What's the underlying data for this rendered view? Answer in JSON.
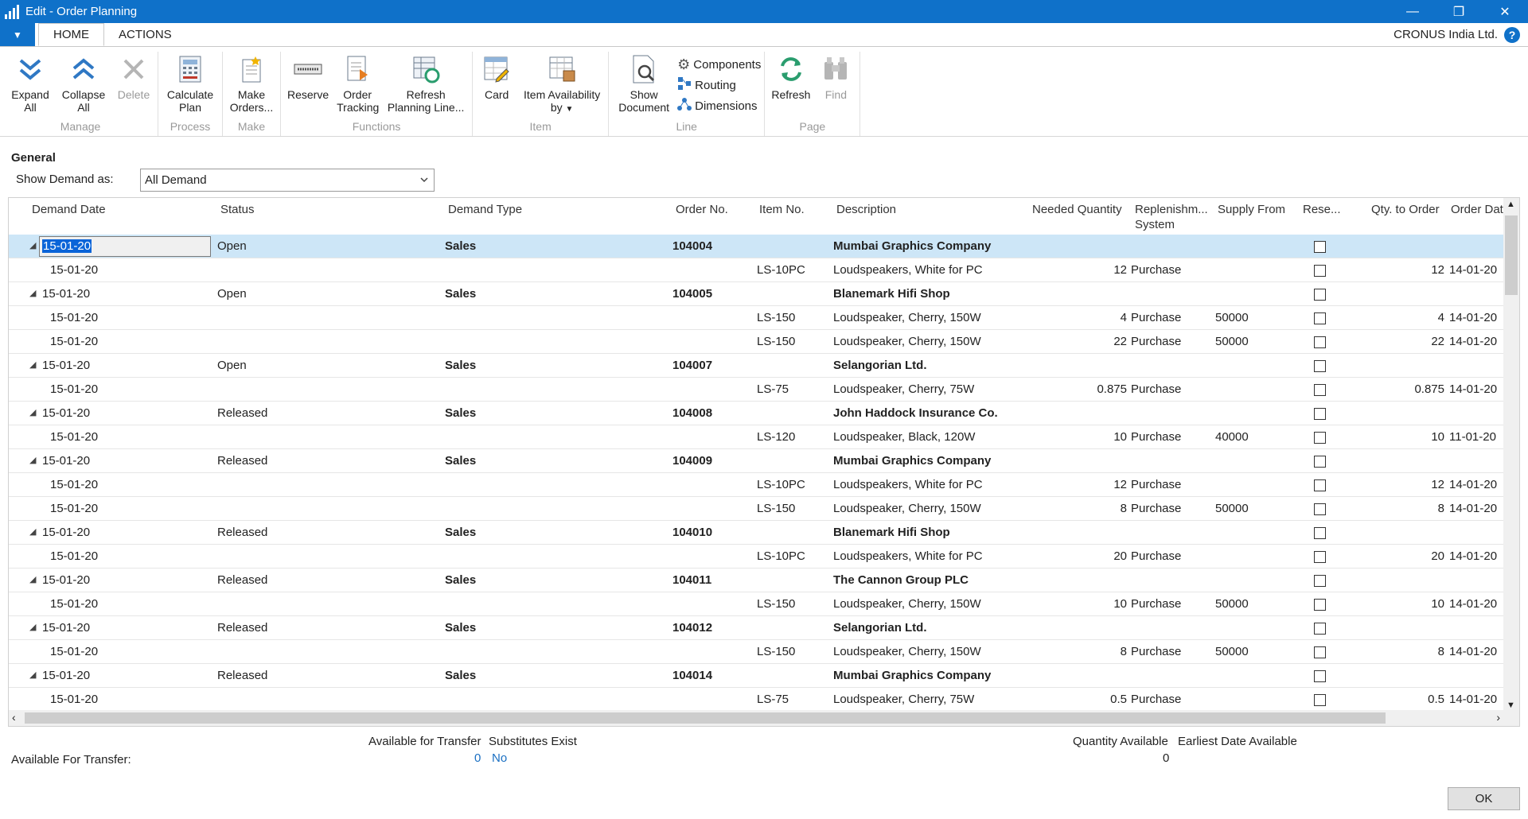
{
  "window": {
    "title": "Edit - Order Planning",
    "minimize": "—",
    "restore": "❐",
    "close": "✕"
  },
  "tabs": [
    {
      "label": "HOME"
    },
    {
      "label": "ACTIONS"
    }
  ],
  "company": "CRONUS India Ltd.",
  "ribbon": {
    "manage": {
      "name": "Manage",
      "expand": "Expand All",
      "collapse": "Collapse All",
      "delete": "Delete"
    },
    "process": {
      "name": "Process",
      "calculate": "Calculate Plan"
    },
    "make": {
      "name": "Make",
      "make_orders": "Make Orders..."
    },
    "functions": {
      "name": "Functions",
      "reserve": "Reserve",
      "order_tracking": "Order Tracking",
      "refresh_planning": "Refresh Planning Line..."
    },
    "item": {
      "name": "Item",
      "card": "Card",
      "item_availability": "Item Availability by"
    },
    "line": {
      "name": "Line",
      "show_document": "Show Document",
      "components": "Components",
      "routing": "Routing",
      "dimensions": "Dimensions"
    },
    "page": {
      "name": "Page",
      "refresh": "Refresh",
      "find": "Find"
    }
  },
  "general": {
    "title": "General",
    "show_demand_label": "Show Demand as:",
    "show_demand_value": "All Demand"
  },
  "columns": {
    "demand_date": "Demand Date",
    "status": "Status",
    "demand_type": "Demand Type",
    "order_no": "Order No.",
    "item_no": "Item No.",
    "description": "Description",
    "needed_qty": "Needed Quantity",
    "replenishment": "Replenishm... System",
    "supply_from": "Supply From",
    "reserve": "Rese...",
    "qty_to_order": "Qty. to Order",
    "order_date": "Order Dat"
  },
  "rows": [
    {
      "parent": true,
      "date": "15-01-20",
      "status": "Open",
      "type": "Sales",
      "order": "104004",
      "desc": "Mumbai Graphics Company"
    },
    {
      "parent": false,
      "date": "15-01-20",
      "item": "LS-10PC",
      "desc": "Loudspeakers, White for PC",
      "qty": "12",
      "repl": "Purchase",
      "supply": "",
      "qto": "12",
      "odate": "14-01-20"
    },
    {
      "parent": true,
      "date": "15-01-20",
      "status": "Open",
      "type": "Sales",
      "order": "104005",
      "desc": "Blanemark Hifi Shop"
    },
    {
      "parent": false,
      "date": "15-01-20",
      "item": "LS-150",
      "desc": "Loudspeaker, Cherry, 150W",
      "qty": "4",
      "repl": "Purchase",
      "supply": "50000",
      "qto": "4",
      "odate": "14-01-20"
    },
    {
      "parent": false,
      "date": "15-01-20",
      "item": "LS-150",
      "desc": "Loudspeaker, Cherry, 150W",
      "qty": "22",
      "repl": "Purchase",
      "supply": "50000",
      "qto": "22",
      "odate": "14-01-20"
    },
    {
      "parent": true,
      "date": "15-01-20",
      "status": "Open",
      "type": "Sales",
      "order": "104007",
      "desc": "Selangorian Ltd."
    },
    {
      "parent": false,
      "date": "15-01-20",
      "item": "LS-75",
      "desc": "Loudspeaker, Cherry, 75W",
      "qty": "0.875",
      "repl": "Purchase",
      "supply": "",
      "qto": "0.875",
      "odate": "14-01-20"
    },
    {
      "parent": true,
      "date": "15-01-20",
      "status": "Released",
      "type": "Sales",
      "order": "104008",
      "desc": "John Haddock Insurance Co."
    },
    {
      "parent": false,
      "date": "15-01-20",
      "item": "LS-120",
      "desc": "Loudspeaker, Black, 120W",
      "qty": "10",
      "repl": "Purchase",
      "supply": "40000",
      "qto": "10",
      "odate": "11-01-20"
    },
    {
      "parent": true,
      "date": "15-01-20",
      "status": "Released",
      "type": "Sales",
      "order": "104009",
      "desc": "Mumbai Graphics Company"
    },
    {
      "parent": false,
      "date": "15-01-20",
      "item": "LS-10PC",
      "desc": "Loudspeakers, White for PC",
      "qty": "12",
      "repl": "Purchase",
      "supply": "",
      "qto": "12",
      "odate": "14-01-20"
    },
    {
      "parent": false,
      "date": "15-01-20",
      "item": "LS-150",
      "desc": "Loudspeaker, Cherry, 150W",
      "qty": "8",
      "repl": "Purchase",
      "supply": "50000",
      "qto": "8",
      "odate": "14-01-20"
    },
    {
      "parent": true,
      "date": "15-01-20",
      "status": "Released",
      "type": "Sales",
      "order": "104010",
      "desc": "Blanemark Hifi Shop"
    },
    {
      "parent": false,
      "date": "15-01-20",
      "item": "LS-10PC",
      "desc": "Loudspeakers, White for PC",
      "qty": "20",
      "repl": "Purchase",
      "supply": "",
      "qto": "20",
      "odate": "14-01-20"
    },
    {
      "parent": true,
      "date": "15-01-20",
      "status": "Released",
      "type": "Sales",
      "order": "104011",
      "desc": "The Cannon Group PLC"
    },
    {
      "parent": false,
      "date": "15-01-20",
      "item": "LS-150",
      "desc": "Loudspeaker, Cherry, 150W",
      "qty": "10",
      "repl": "Purchase",
      "supply": "50000",
      "qto": "10",
      "odate": "14-01-20"
    },
    {
      "parent": true,
      "date": "15-01-20",
      "status": "Released",
      "type": "Sales",
      "order": "104012",
      "desc": "Selangorian Ltd."
    },
    {
      "parent": false,
      "date": "15-01-20",
      "item": "LS-150",
      "desc": "Loudspeaker, Cherry, 150W",
      "qty": "8",
      "repl": "Purchase",
      "supply": "50000",
      "qto": "8",
      "odate": "14-01-20"
    },
    {
      "parent": true,
      "date": "15-01-20",
      "status": "Released",
      "type": "Sales",
      "order": "104014",
      "desc": "Mumbai Graphics Company"
    },
    {
      "parent": false,
      "date": "15-01-20",
      "item": "LS-75",
      "desc": "Loudspeaker, Cherry, 75W",
      "qty": "0.5",
      "repl": "Purchase",
      "supply": "",
      "qto": "0.5",
      "odate": "14-01-20"
    }
  ],
  "footer": {
    "available_for_transfer_label": "Available For Transfer:",
    "available_for_transfer_hdr": "Available for Transfer",
    "available_for_transfer_val": "0",
    "substitutes_hdr": "Substitutes Exist",
    "substitutes_val": "No",
    "qty_available_hdr": "Quantity Available",
    "qty_available_val": "0",
    "earliest_date_hdr": "Earliest Date Available"
  },
  "ok_label": "OK",
  "colors": {
    "accent": "#0f71c9",
    "selected_row": "#cde6f7",
    "link": "#1a6fc2"
  }
}
